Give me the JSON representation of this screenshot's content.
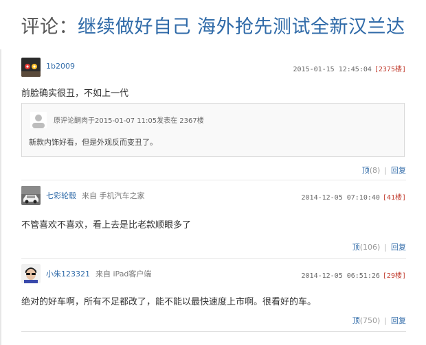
{
  "header": {
    "prefix": "评论：",
    "article_title": "继续做好自己 海外抢先测试全新汉兰达"
  },
  "comments": [
    {
      "username": "1b2009",
      "source_prefix": "",
      "device": "",
      "timestamp": "2015-01-15 12:45:04",
      "floor": "[2375楼]",
      "text": "前脸确实很丑，不如上一代",
      "quote": {
        "line": "原评论酮肉于2015-01-07 11:05发表在 2367楼",
        "text": "新款内饰好看，但是外观反而变丑了。"
      },
      "vote_label": "顶",
      "vote_count": "(8)",
      "separator": "|",
      "reply_label": "回复"
    },
    {
      "username": "七彩轮毂",
      "source_prefix": "来自",
      "device": "手机汽车之家",
      "timestamp": "2014-12-05 07:10:40",
      "floor": "[41楼]",
      "text": "不管喜欢不喜欢，看上去是比老款顺眼多了",
      "vote_label": "顶",
      "vote_count": "(106)",
      "separator": "|",
      "reply_label": "回复"
    },
    {
      "username": "小朱123321",
      "source_prefix": "来自",
      "device": "iPad客户端",
      "timestamp": "2014-12-05 06:51:26",
      "floor": "[29楼]",
      "text": "绝对的好车啊，所有不足都改了，能不能以最快速度上市啊。很看好的车。",
      "vote_label": "顶",
      "vote_count": "(750)",
      "separator": "|",
      "reply_label": "回复"
    }
  ],
  "colors": {
    "link": "#2f6aa8",
    "floor": "#c0392b",
    "title_prefix": "#555555"
  }
}
